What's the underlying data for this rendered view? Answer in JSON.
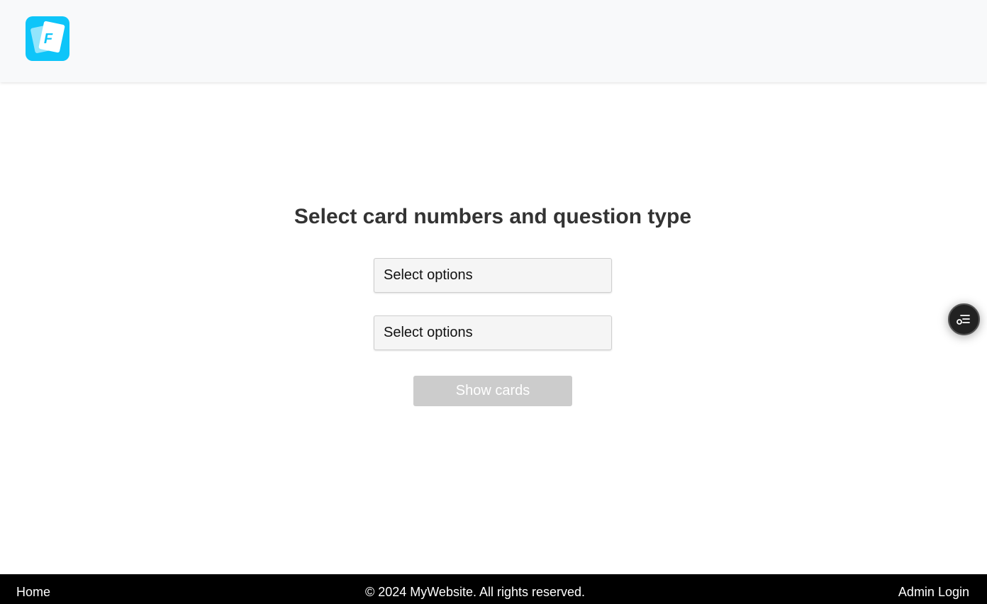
{
  "header": {
    "logo_icon": "flashcards-logo-icon",
    "logo_letter": "F",
    "logo_color": "#0ec5f9"
  },
  "main": {
    "title": "Select card numbers and question type",
    "card_numbers_select": {
      "value": "Select options"
    },
    "question_type_select": {
      "value": "Select options"
    },
    "show_cards_label": "Show cards",
    "show_cards_color": "#cccccc"
  },
  "floating_button": {
    "icon": "filter-list-icon"
  },
  "footer": {
    "home_label": "Home",
    "copyright": "© 2024 MyWebsite. All rights reserved.",
    "admin_label": "Admin Login"
  }
}
